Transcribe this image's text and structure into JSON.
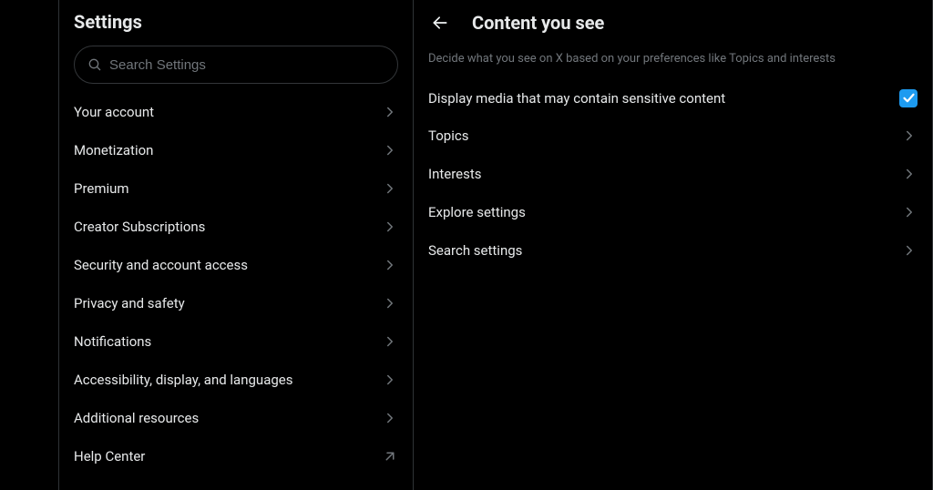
{
  "settings": {
    "title": "Settings",
    "search_placeholder": "Search Settings",
    "items": [
      {
        "label": "Your account",
        "external": false
      },
      {
        "label": "Monetization",
        "external": false
      },
      {
        "label": "Premium",
        "external": false
      },
      {
        "label": "Creator Subscriptions",
        "external": false
      },
      {
        "label": "Security and account access",
        "external": false
      },
      {
        "label": "Privacy and safety",
        "external": false
      },
      {
        "label": "Notifications",
        "external": false
      },
      {
        "label": "Accessibility, display, and languages",
        "external": false
      },
      {
        "label": "Additional resources",
        "external": false
      },
      {
        "label": "Help Center",
        "external": true
      }
    ]
  },
  "detail": {
    "title": "Content you see",
    "description": "Decide what you see on X based on your preferences like Topics and interests",
    "toggle": {
      "label": "Display media that may contain sensitive content",
      "checked": true
    },
    "rows": [
      {
        "label": "Topics"
      },
      {
        "label": "Interests"
      },
      {
        "label": "Explore settings"
      },
      {
        "label": "Search settings"
      }
    ]
  },
  "colors": {
    "accent": "#1d9bf0",
    "text_muted": "#71767b",
    "border": "#2f3336"
  }
}
